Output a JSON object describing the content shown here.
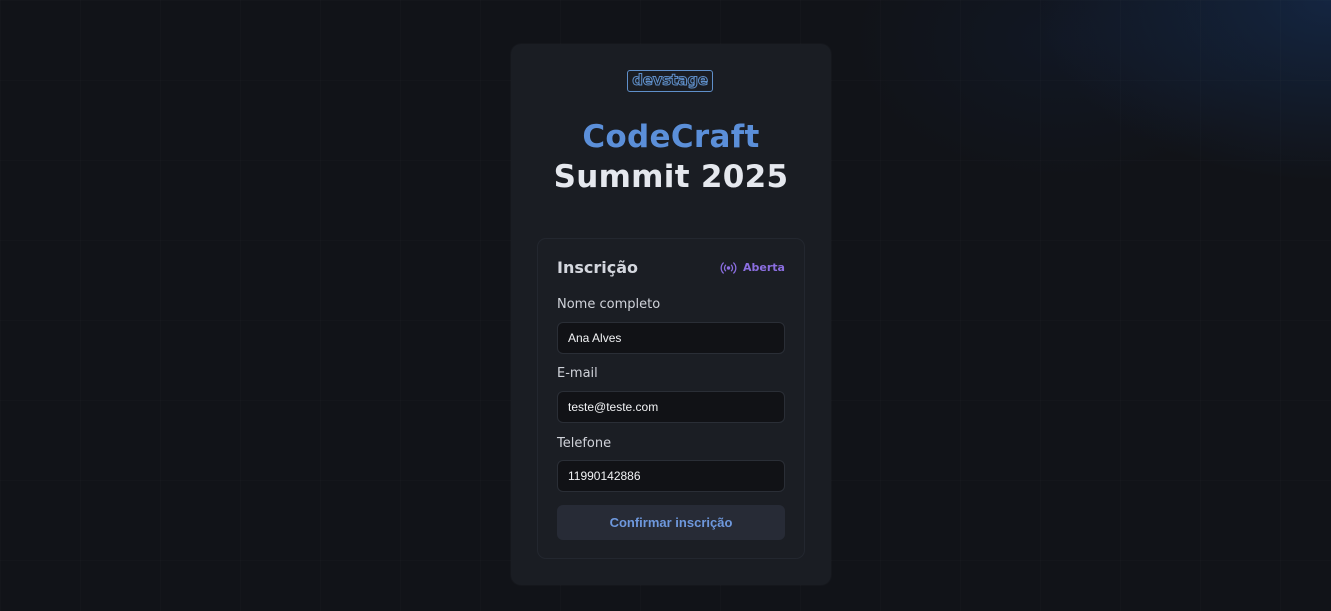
{
  "brand": {
    "logo_text": "devstage",
    "logo_color": "#5f8fc9"
  },
  "event": {
    "title_line1": "CodeCraft",
    "title_line2": "Summit 2025",
    "accent_color": "#5b8fd9"
  },
  "form": {
    "title": "Inscrição",
    "status": {
      "label": "Aberta",
      "icon": "broadcast-icon",
      "color": "#8b6ee0"
    },
    "fields": [
      {
        "label": "Nome completo",
        "value": "Ana Alves"
      },
      {
        "label": "E-mail",
        "value": "teste@teste.com"
      },
      {
        "label": "Telefone",
        "value": "11990142886"
      }
    ],
    "submit_label": "Confirmar inscrição"
  }
}
